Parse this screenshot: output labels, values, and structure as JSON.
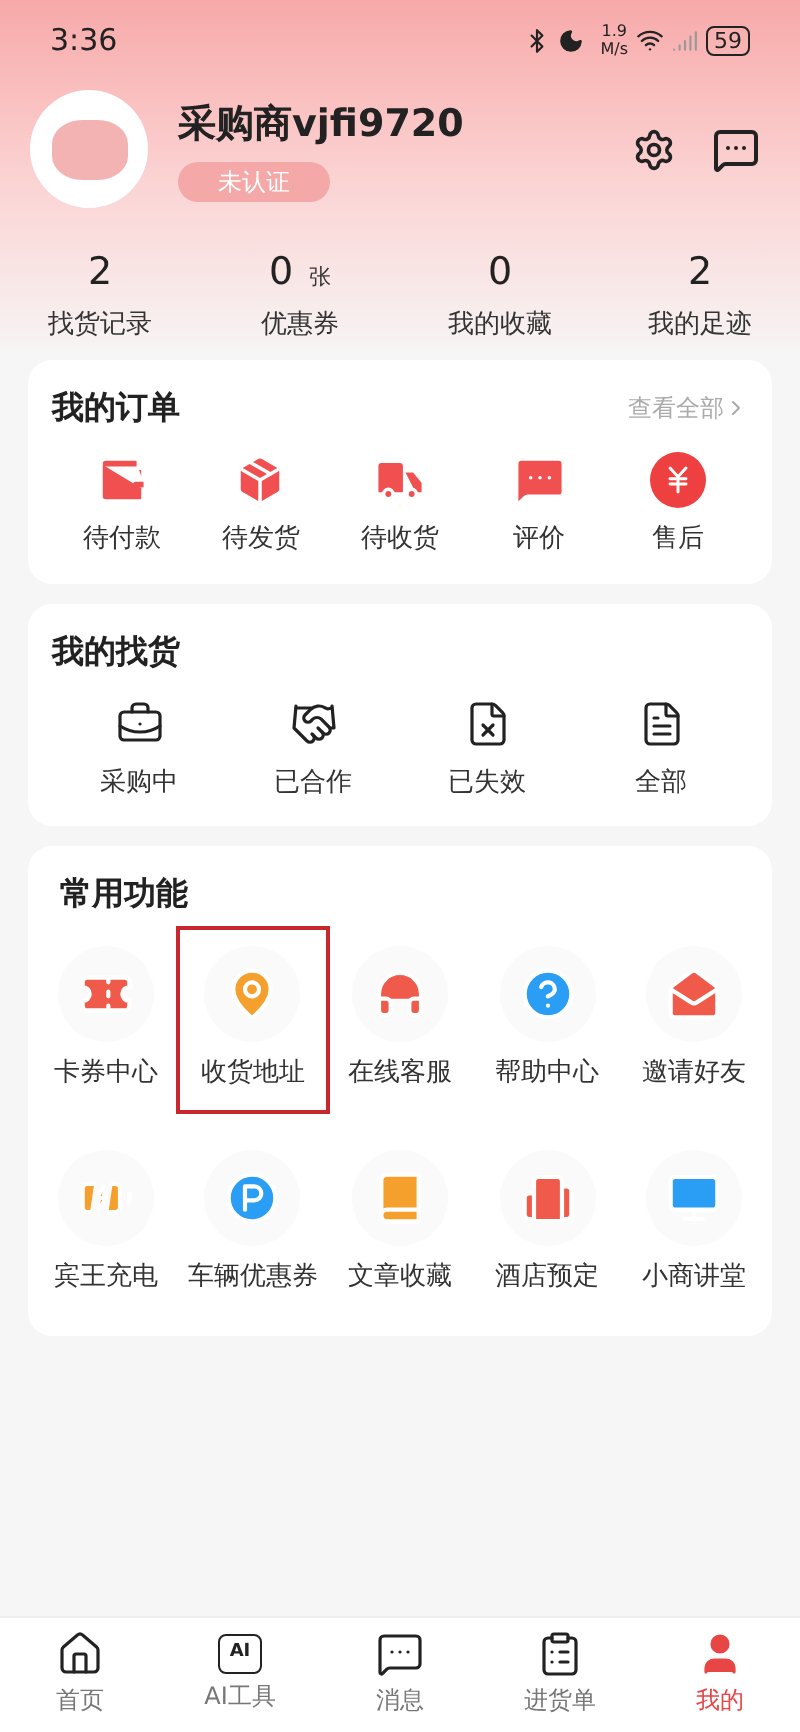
{
  "status_bar": {
    "time": "3:36",
    "speed_value": "1.9",
    "speed_unit": "M/s",
    "battery": "59"
  },
  "profile": {
    "name": "采购商vjfi9720",
    "badge": "未认证"
  },
  "stats": [
    {
      "value": "2",
      "label": "找货记录"
    },
    {
      "value": "0",
      "unit": "张",
      "label": "优惠券"
    },
    {
      "value": "0",
      "label": "我的收藏"
    },
    {
      "value": "2",
      "label": "我的足迹"
    }
  ],
  "orders": {
    "title": "我的订单",
    "link": "查看全部",
    "items": [
      {
        "label": "待付款"
      },
      {
        "label": "待发货"
      },
      {
        "label": "待收货"
      },
      {
        "label": "评价"
      },
      {
        "label": "售后"
      }
    ]
  },
  "sourcing": {
    "title": "我的找货",
    "items": [
      {
        "label": "采购中"
      },
      {
        "label": "已合作"
      },
      {
        "label": "已失效"
      },
      {
        "label": "全部"
      }
    ]
  },
  "functions": {
    "title": "常用功能",
    "items": [
      {
        "label": "卡券中心",
        "highlighted": false
      },
      {
        "label": "收货地址",
        "highlighted": true
      },
      {
        "label": "在线客服",
        "highlighted": false
      },
      {
        "label": "帮助中心",
        "highlighted": false
      },
      {
        "label": "邀请好友",
        "highlighted": false
      },
      {
        "label": "宾王充电",
        "highlighted": false
      },
      {
        "label": "车辆优惠券",
        "highlighted": false
      },
      {
        "label": "文章收藏",
        "highlighted": false
      },
      {
        "label": "酒店预定",
        "highlighted": false
      },
      {
        "label": "小商讲堂",
        "highlighted": false
      }
    ]
  },
  "tab_bar": [
    {
      "label": "首页",
      "selected": false
    },
    {
      "label": "AI工具",
      "icon_text": "AI",
      "selected": false
    },
    {
      "label": "消息",
      "selected": false
    },
    {
      "label": "进货单",
      "selected": false
    },
    {
      "label": "我的",
      "selected": true
    }
  ]
}
